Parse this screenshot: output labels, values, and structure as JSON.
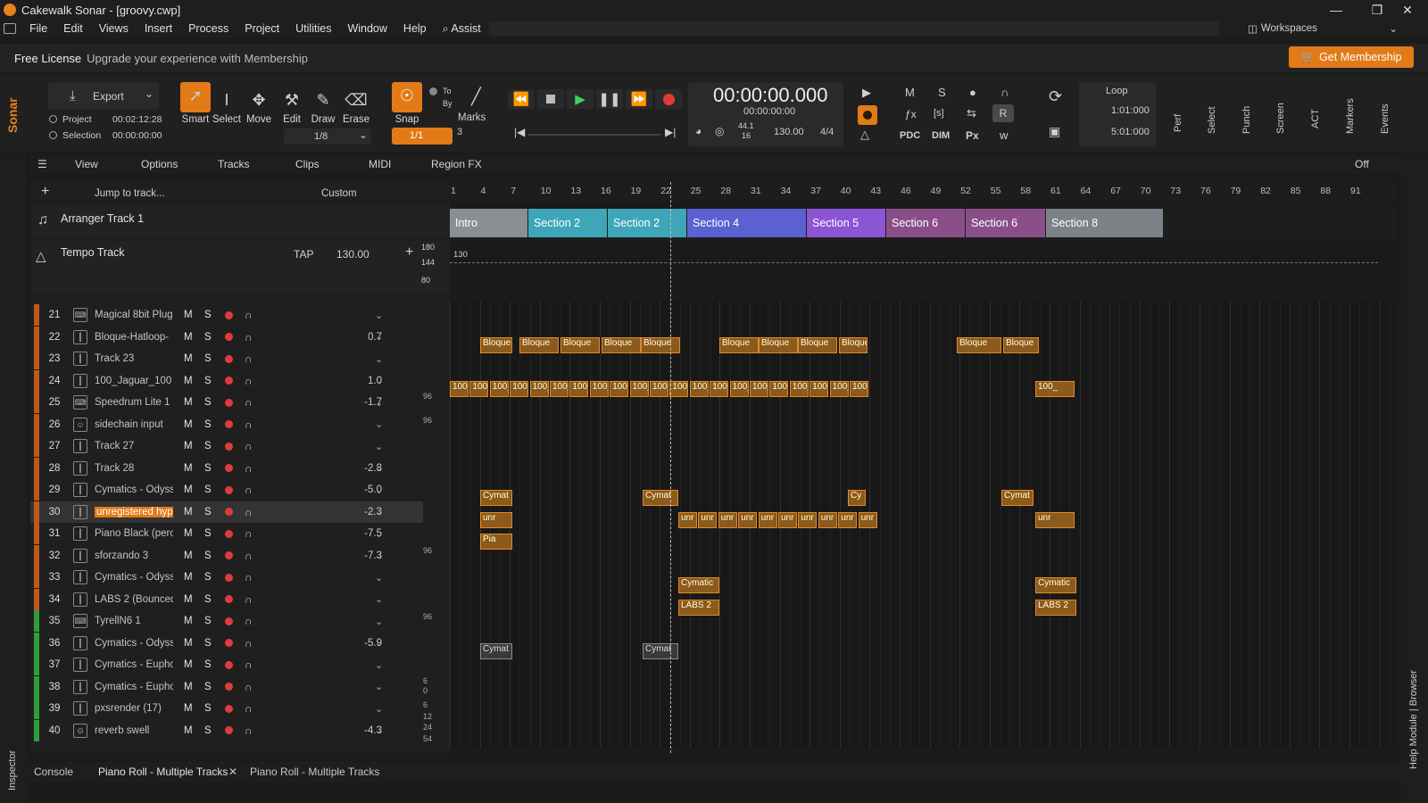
{
  "app": {
    "title": "Cakewalk Sonar - [groovy.cwp]",
    "window_controls": [
      "—",
      "❐",
      "✕"
    ]
  },
  "menu": {
    "items": [
      "File",
      "Edit",
      "Views",
      "Insert",
      "Process",
      "Project",
      "Utilities",
      "Window",
      "Help",
      "⌕ Assist"
    ],
    "workspaces_label": "Workspaces"
  },
  "license": {
    "title": "Free License",
    "message": "Upgrade your experience with Membership",
    "cta": "Get Membership"
  },
  "control_bar": {
    "brand": "Sonar",
    "export_label": "Export",
    "project_label": "Project",
    "project_time": "00:02:12:28",
    "selection_label": "Selection",
    "selection_time": "00:00:00:00",
    "tools": [
      "Smart",
      "Select",
      "Move",
      "Edit",
      "Draw",
      "Erase"
    ],
    "snap_fraction": "1/8",
    "snap_label": "Snap",
    "snap_value": "1/1",
    "to_label": "To",
    "by_label": "By",
    "marks_label": "Marks",
    "marks_value": "3",
    "time_main": "00:00:00.000",
    "time_sub": "00:00:00:00",
    "sample_rate_top": "44.1",
    "sample_rate_bottom": "16",
    "tempo": "130.00",
    "meter": "4/4",
    "mix_buttons": [
      "M",
      "S",
      "●",
      "∩"
    ],
    "pdc_label": "PDC",
    "dim_label": "DIM",
    "px_label": "Px",
    "r_label": "R",
    "loop_label": "Loop",
    "loop_start": "1:01:000",
    "loop_end": "5:01:000",
    "side_modules": [
      "Perf",
      "Select",
      "Punch",
      "Screen",
      "ACT",
      "Markers",
      "Events"
    ]
  },
  "view_bar": {
    "items": [
      "View",
      "Options",
      "Tracks",
      "Clips",
      "MIDI",
      "Region FX"
    ],
    "off_label": "Off"
  },
  "track_header": {
    "jump_placeholder": "Jump to track...",
    "custom_label": "Custom"
  },
  "arranger": {
    "name": "Arranger Track 1",
    "sections": [
      {
        "label": "Intro",
        "color": "#8a8f96"
      },
      {
        "label": "Section 2",
        "color": "#3ea6b8"
      },
      {
        "label": "Section 2",
        "color": "#3ea6b8"
      },
      {
        "label": "Section 4",
        "color": "#5b61d0"
      },
      {
        "label": "Section 5",
        "color": "#8b55d4"
      },
      {
        "label": "Section 6",
        "color": "#8a4f88"
      },
      {
        "label": "Section 6",
        "color": "#8a4f88"
      },
      {
        "label": "Section 8",
        "color": "#7d8288"
      }
    ]
  },
  "tempo_track": {
    "name": "Tempo Track",
    "tap": "TAP",
    "value": "130.00",
    "scale_top": "180",
    "scale_mid": "144",
    "scale_bottom": "80",
    "marker": "130"
  },
  "ruler": {
    "ticks": [
      "1",
      "4",
      "7",
      "10",
      "13",
      "16",
      "19",
      "22",
      "25",
      "28",
      "31",
      "34",
      "37",
      "40",
      "43",
      "46",
      "49",
      "52",
      "55",
      "58",
      "61",
      "64",
      "67",
      "70",
      "73",
      "76",
      "79",
      "82",
      "85",
      "88",
      "91"
    ]
  },
  "tracks": [
    {
      "num": "21",
      "icon": "synth",
      "name": "Magical 8bit Plug",
      "vol": "",
      "color": "#c0581a"
    },
    {
      "num": "22",
      "icon": "audio",
      "name": "Bloque-Hatloop-",
      "vol": "0.7",
      "color": "#c0581a"
    },
    {
      "num": "23",
      "icon": "audio",
      "name": "Track 23",
      "vol": "",
      "color": "#c0581a"
    },
    {
      "num": "24",
      "icon": "audio",
      "name": "100_Jaguar_100 (",
      "vol": "1.0",
      "color": "#c0581a"
    },
    {
      "num": "25",
      "icon": "synth",
      "name": "Speedrum Lite 1",
      "vol": "-1.7",
      "color": "#c0581a"
    },
    {
      "num": "26",
      "icon": "sidechain",
      "name": "sidechain input",
      "vol": "",
      "color": "#c0581a"
    },
    {
      "num": "27",
      "icon": "audio",
      "name": "Track 27",
      "vol": "",
      "color": "#c0581a"
    },
    {
      "num": "28",
      "icon": "audio",
      "name": "Track 28",
      "vol": "-2.8",
      "color": "#c0581a"
    },
    {
      "num": "29",
      "icon": "audio",
      "name": "Cymatics - Odyss",
      "vol": "-5.0",
      "color": "#c0581a"
    },
    {
      "num": "30",
      "icon": "audio",
      "name": "unregistered hyp",
      "vol": "-2.3",
      "color": "#c0581a"
    },
    {
      "num": "31",
      "icon": "audio",
      "name": "Piano Black (perc",
      "vol": "-7.5",
      "color": "#c0581a"
    },
    {
      "num": "32",
      "icon": "audio",
      "name": "sforzando 3",
      "vol": "-7.3",
      "color": "#c0581a"
    },
    {
      "num": "33",
      "icon": "audio",
      "name": "Cymatics - Odyss",
      "vol": "",
      "color": "#c0581a"
    },
    {
      "num": "34",
      "icon": "audio",
      "name": "LABS 2 (Bounced,",
      "vol": "",
      "color": "#c0581a"
    },
    {
      "num": "35",
      "icon": "synth",
      "name": "TyrellN6 1",
      "vol": "",
      "color": "#2f9e3a"
    },
    {
      "num": "36",
      "icon": "audio",
      "name": "Cymatics - Odyss",
      "vol": "-5.9",
      "color": "#2f9e3a"
    },
    {
      "num": "37",
      "icon": "audio",
      "name": "Cymatics - Euphc",
      "vol": "",
      "color": "#2f9e3a"
    },
    {
      "num": "38",
      "icon": "audio",
      "name": "Cymatics - Euphc",
      "vol": "",
      "color": "#2f9e3a"
    },
    {
      "num": "39",
      "icon": "audio",
      "name": "pxsrender (17)",
      "vol": "",
      "color": "#2f9e3a"
    },
    {
      "num": "40",
      "icon": "bus",
      "name": "reverb swell",
      "vol": "-4.3",
      "color": "#2f9e3a"
    }
  ],
  "clip_labels": {
    "bloque": "Bloque",
    "jaguar": "100_",
    "cymat": "Cymat",
    "cymatic": "Cymatic",
    "unr": "unr",
    "pia": "Pia",
    "labs": "LABS 2",
    "cy": "Cy"
  },
  "lane_scale": [
    "96",
    "96",
    "96",
    "96",
    "6",
    "0",
    "6",
    "12",
    "24",
    "54"
  ],
  "right_strip": {
    "help_label": "Help Module | Browser"
  },
  "left_strip": {
    "inspector_label": "Inspector"
  },
  "bottom_tabs": [
    "Console",
    "Piano Roll - Multiple Tracks",
    "Piano Roll - Multiple Tracks"
  ]
}
